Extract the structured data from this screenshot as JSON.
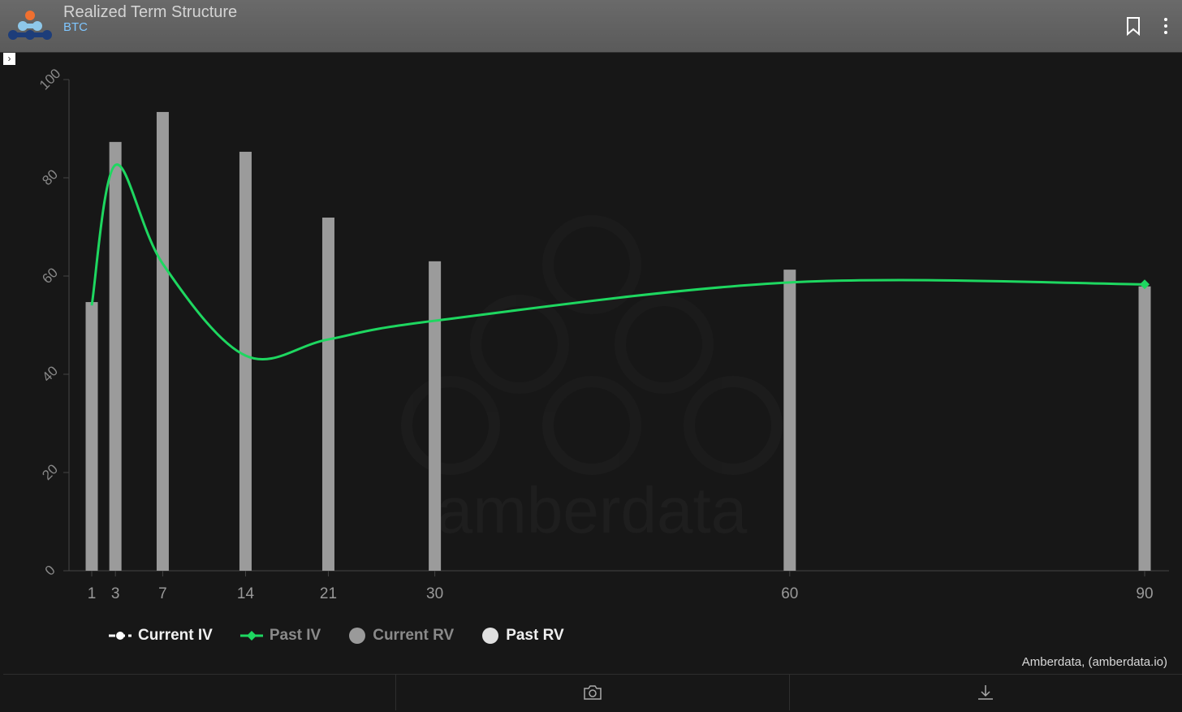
{
  "header": {
    "title": "Realized Term Structure",
    "subtitle": "BTC",
    "bookmark_icon": "bookmark-icon",
    "menu_icon": "kebab-menu-icon"
  },
  "toggle_icon": "chevron-right-icon",
  "watermark": "amberdata",
  "credit": "Amberdata, (amberdata.io)",
  "legend": [
    {
      "label": "Current IV",
      "color": "#ffffff",
      "text_color": "#f0f0f0"
    },
    {
      "label": "Past IV",
      "color": "#1ed760",
      "text_color": "#8a8a8a"
    },
    {
      "label": "Current RV",
      "color": "#9a9a9a",
      "text_color": "#8a8a8a"
    },
    {
      "label": "Past RV",
      "color": "#e0e0e0",
      "text_color": "#f0f0f0"
    }
  ],
  "footer": {
    "camera_icon": "camera-icon",
    "download_icon": "download-icon"
  },
  "chart_data": {
    "type": "bar+line",
    "x": [
      1,
      3,
      7,
      14,
      21,
      30,
      60,
      90
    ],
    "xlim": [
      1,
      90
    ],
    "ylim": [
      0,
      100
    ],
    "yticks": [
      0,
      20,
      40,
      60,
      80,
      100
    ],
    "series": [
      {
        "name": "Past RV",
        "type": "bar",
        "color": "#9b9b9b",
        "values": [
          54.7,
          87.3,
          93.4,
          85.3,
          71.9,
          63.0,
          61.3,
          57.9
        ]
      },
      {
        "name": "Past IV",
        "type": "line",
        "color": "#1ed760",
        "values": [
          54,
          82.6,
          62.5,
          43.8,
          47.1,
          50.9,
          58.7,
          58.3
        ]
      }
    ],
    "grid": false
  }
}
